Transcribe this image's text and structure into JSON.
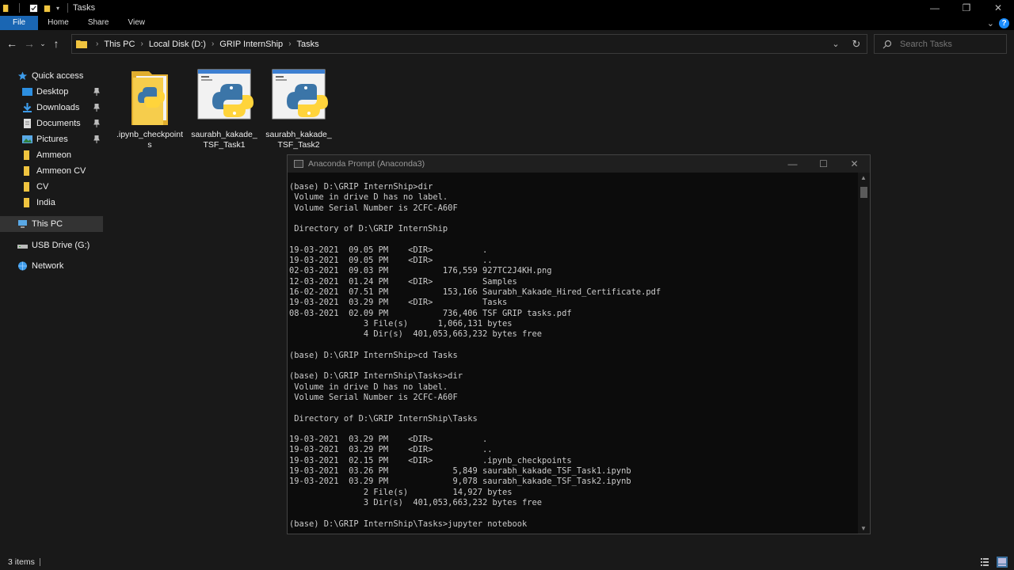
{
  "window": {
    "title": "Tasks"
  },
  "ribbon": {
    "tabs": [
      "File",
      "Home",
      "Share",
      "View"
    ]
  },
  "address": {
    "crumbs": [
      "This PC",
      "Local Disk (D:)",
      "GRIP InternShip",
      "Tasks"
    ]
  },
  "search": {
    "placeholder": "Search Tasks"
  },
  "sidebar": {
    "items": [
      {
        "label": "Quick access",
        "icon": "star-icon",
        "pinned": false
      },
      {
        "label": "Desktop",
        "icon": "desktop-icon",
        "pinned": true
      },
      {
        "label": "Downloads",
        "icon": "download-icon",
        "pinned": true
      },
      {
        "label": "Documents",
        "icon": "document-icon",
        "pinned": true
      },
      {
        "label": "Pictures",
        "icon": "pictures-icon",
        "pinned": true
      },
      {
        "label": "Ammeon",
        "icon": "folder-icon",
        "pinned": false
      },
      {
        "label": "Ammeon CV",
        "icon": "folder-icon",
        "pinned": false
      },
      {
        "label": "CV",
        "icon": "folder-icon",
        "pinned": false
      },
      {
        "label": "India",
        "icon": "folder-icon",
        "pinned": false
      },
      {
        "label": "This PC",
        "icon": "computer-icon",
        "pinned": false
      },
      {
        "label": "USB Drive (G:)",
        "icon": "usb-drive-icon",
        "pinned": false
      },
      {
        "label": "Network",
        "icon": "network-icon",
        "pinned": false
      }
    ]
  },
  "files": [
    {
      "name": ".ipynb_checkpoints",
      "icon": "folder-python-icon"
    },
    {
      "name": "saurabh_kakade_TSF_Task1",
      "icon": "python-file-icon"
    },
    {
      "name": "saurabh_kakade_TSF_Task2",
      "icon": "python-file-icon"
    }
  ],
  "terminal": {
    "title": "Anaconda Prompt (Anaconda3)",
    "lines": [
      "(base) D:\\GRIP InternShip>dir",
      " Volume in drive D has no label.",
      " Volume Serial Number is 2CFC-A60F",
      "",
      " Directory of D:\\GRIP InternShip",
      "",
      "19-03-2021  09.05 PM    <DIR>          .",
      "19-03-2021  09.05 PM    <DIR>          ..",
      "02-03-2021  09.03 PM           176,559 927TC2J4KH.png",
      "12-03-2021  01.24 PM    <DIR>          Samples",
      "16-02-2021  07.51 PM           153,166 Saurabh_Kakade_Hired_Certificate.pdf",
      "19-03-2021  03.29 PM    <DIR>          Tasks",
      "08-03-2021  02.09 PM           736,406 TSF GRIP tasks.pdf",
      "               3 File(s)      1,066,131 bytes",
      "               4 Dir(s)  401,053,663,232 bytes free",
      "",
      "(base) D:\\GRIP InternShip>cd Tasks",
      "",
      "(base) D:\\GRIP InternShip\\Tasks>dir",
      " Volume in drive D has no label.",
      " Volume Serial Number is 2CFC-A60F",
      "",
      " Directory of D:\\GRIP InternShip\\Tasks",
      "",
      "19-03-2021  03.29 PM    <DIR>          .",
      "19-03-2021  03.29 PM    <DIR>          ..",
      "19-03-2021  02.15 PM    <DIR>          .ipynb_checkpoints",
      "19-03-2021  03.26 PM             5,849 saurabh_kakade_TSF_Task1.ipynb",
      "19-03-2021  03.29 PM             9,078 saurabh_kakade_TSF_Task2.ipynb",
      "               2 File(s)         14,927 bytes",
      "               3 Dir(s)  401,053,663,232 bytes free",
      "",
      "(base) D:\\GRIP InternShip\\Tasks>jupyter notebook"
    ]
  },
  "status": {
    "item_count": "3 items"
  },
  "colors": {
    "accent": "#1a66b3",
    "folder": "#f0c43f",
    "python_blue": "#3b75a8",
    "python_yellow": "#ffd43b"
  }
}
